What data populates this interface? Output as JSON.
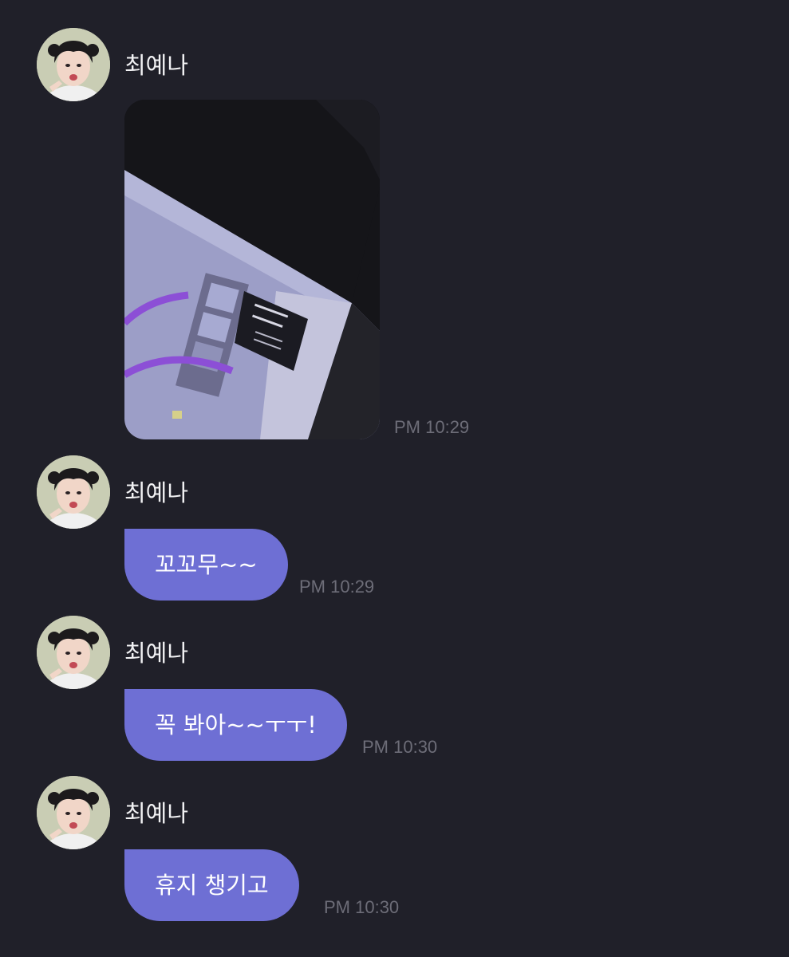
{
  "chat": {
    "messages": [
      {
        "sender": "최예나",
        "type": "image",
        "image_alt": "",
        "time": "PM 10:29"
      },
      {
        "sender": "최예나",
        "type": "text",
        "text": "꼬꼬무~~",
        "time": "PM 10:29"
      },
      {
        "sender": "최예나",
        "type": "text",
        "text": "꼭 봐아~~ㅜㅜ!",
        "time": "PM 10:30"
      },
      {
        "sender": "최예나",
        "type": "text",
        "text": "휴지 챙기고",
        "time": "PM 10:30"
      }
    ]
  },
  "colors": {
    "background": "#202029",
    "bubble": "#6e6fd4",
    "bubble_text": "#ffffff",
    "sender_text": "#f2f2f4",
    "time_text": "#6d6d78"
  },
  "icons": {
    "avatar": "profile-photo",
    "photo": "shared-photo"
  }
}
